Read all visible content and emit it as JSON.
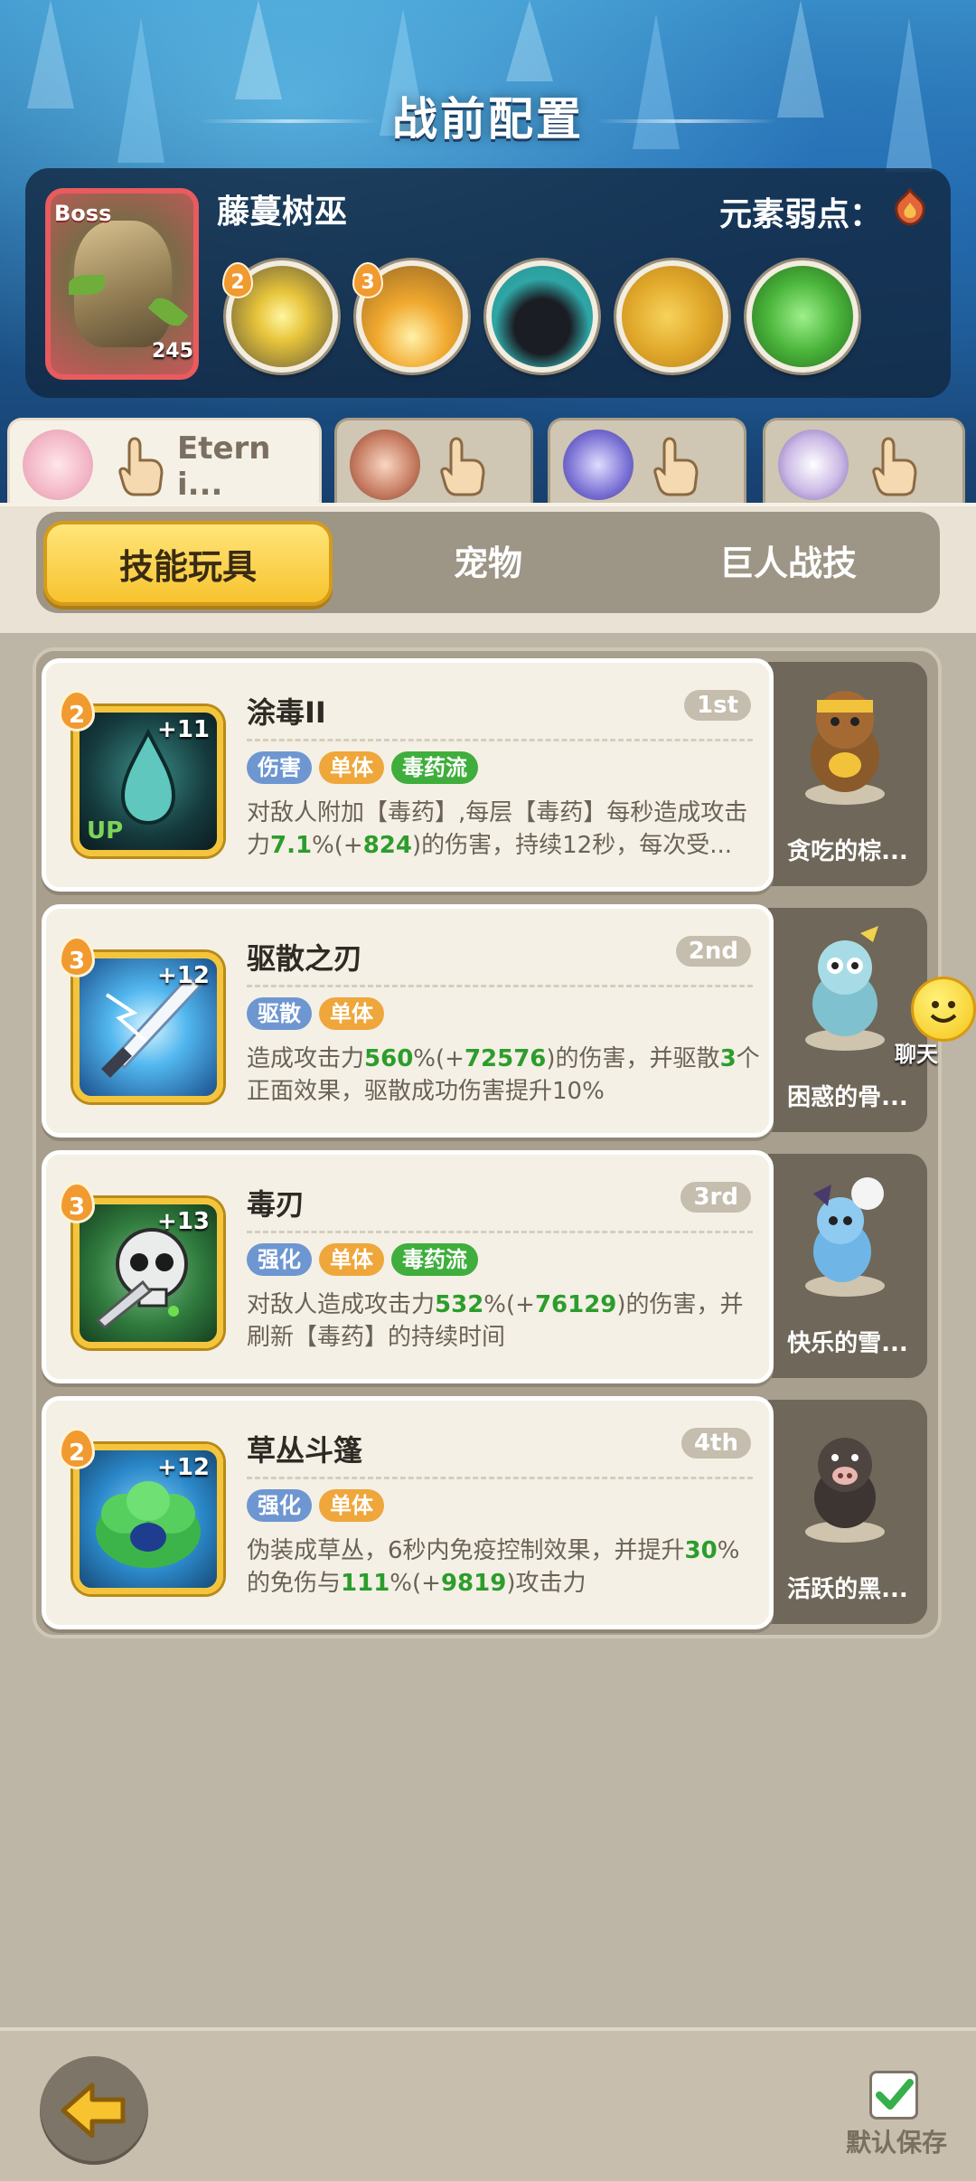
{
  "header": {
    "title": "战前配置",
    "boss_tag": "Boss",
    "boss_level": "245",
    "boss_name": "藤蔓树巫",
    "weakness_label": "元素弱点：",
    "weakness_icon": "fire-element-icon",
    "boss_skills": [
      {
        "level": "2",
        "icon": "explosion-skill-icon"
      },
      {
        "level": "3",
        "icon": "fire-burst-skill-icon"
      },
      {
        "level": "",
        "icon": "shadow-beast-skill-icon"
      },
      {
        "level": "",
        "icon": "golden-fish-skill-icon"
      },
      {
        "level": "",
        "icon": "green-slime-skill-icon"
      }
    ]
  },
  "hero_tabs": [
    {
      "name": "Eterni...",
      "active": true
    },
    {
      "name": "",
      "active": false
    },
    {
      "name": "",
      "active": false
    },
    {
      "name": "",
      "active": false
    }
  ],
  "segment_tabs": [
    "技能玩具",
    "宠物",
    "巨人战技"
  ],
  "skills": [
    {
      "level": "2",
      "plus": "+11",
      "name": "涂毒II",
      "rank": "1st",
      "tags": [
        {
          "t": "伤害",
          "c": "blue"
        },
        {
          "t": "单体",
          "c": "orange"
        },
        {
          "t": "毒药流",
          "c": "green"
        }
      ],
      "desc": [
        "对敌人附加【毒药】,每层【毒药】每秒造成攻击力",
        "7.1",
        "%(+",
        "824",
        ")的伤害，持续12秒，每次受..."
      ],
      "pet_name": "贪吃的棕...",
      "icon_badge": "UP"
    },
    {
      "level": "3",
      "plus": "+12",
      "name": "驱散之刃",
      "rank": "2nd",
      "tags": [
        {
          "t": "驱散",
          "c": "blue"
        },
        {
          "t": "单体",
          "c": "orange"
        }
      ],
      "desc": [
        "造成攻击力",
        "560",
        "%(+",
        "72576",
        ")的伤害，并驱散",
        "3",
        "个正面效果，驱散成功伤害提升10%"
      ],
      "pet_name": "困惑的骨..."
    },
    {
      "level": "3",
      "plus": "+13",
      "name": "毒刃",
      "rank": "3rd",
      "tags": [
        {
          "t": "强化",
          "c": "blue"
        },
        {
          "t": "单体",
          "c": "orange"
        },
        {
          "t": "毒药流",
          "c": "green"
        }
      ],
      "desc": [
        "对敌人造成攻击力",
        "532",
        "%(+",
        "76129",
        ")的伤害，并刷新【毒药】的持续时间"
      ],
      "pet_name": "快乐的雪..."
    },
    {
      "level": "2",
      "plus": "+12",
      "name": "草丛斗篷",
      "rank": "4th",
      "tags": [
        {
          "t": "强化",
          "c": "blue"
        },
        {
          "t": "单体",
          "c": "orange"
        }
      ],
      "desc": [
        "伪装成草丛，6秒内免疫控制效果，并提升",
        "30",
        "%的免伤与",
        "111",
        "%(+",
        "9819",
        ")攻击力"
      ],
      "pet_name": "活跃的黑..."
    }
  ],
  "chat_label": "聊天",
  "footer": {
    "save_label": "默认保存",
    "back_icon": "back-arrow-icon"
  },
  "colors": {
    "accent_yellow": "#f7c32e",
    "highlight_green": "#2c9d2c",
    "boss_red": "#e85b5e"
  }
}
